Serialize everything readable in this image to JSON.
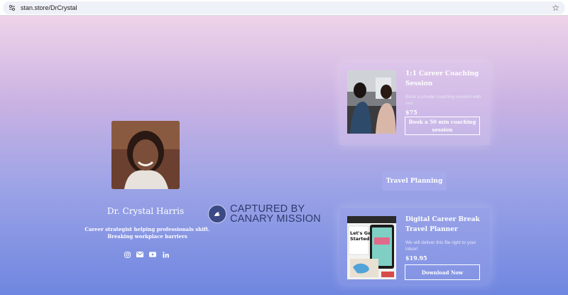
{
  "browser": {
    "url": "stan.store/DrCrystal"
  },
  "profile": {
    "name": "Dr. Crystal Harris",
    "bio": "Career strategist helping professionals shift. Breaking workplace barriers",
    "socials": [
      "instagram-icon",
      "email-icon",
      "youtube-icon",
      "linkedin-icon"
    ]
  },
  "watermark": {
    "line1": "CAPTURED BY",
    "line2": "CANARY MISSION"
  },
  "products": [
    {
      "title": "1:1 Career Coaching Session",
      "description": "Book a private coaching session with me!",
      "price": "$75",
      "button": "Book a 50 min coaching session"
    },
    {
      "title": "Digital Career Break Travel Planner",
      "description": "We will deliver this file right to your inbox!",
      "price": "$19.95",
      "button": "Download Now"
    }
  ],
  "section": {
    "label": "Travel Planning"
  },
  "colors": {
    "gradient_top": "#f6d9ea",
    "gradient_bottom": "#6f86e0",
    "watermark": "#2f3a6e"
  }
}
